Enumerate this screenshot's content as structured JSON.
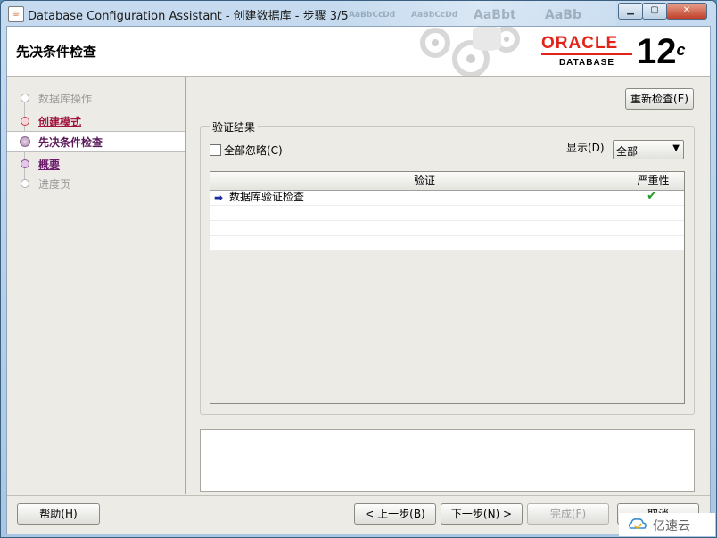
{
  "window": {
    "title": "Database Configuration Assistant - 创建数据库 - 步骤 3/5",
    "ghost_tabs": [
      "AaBbCcDd",
      "AaBbCcDd",
      "AaBbt",
      "AaBb"
    ],
    "minimize_icon": "minimize-icon",
    "maximize_icon": "maximize-icon",
    "close_icon": "close-icon"
  },
  "header": {
    "title": "先决条件检查",
    "brand": "ORACLE",
    "product": "DATABASE",
    "version": "12",
    "version_suffix": "c"
  },
  "sidebar": {
    "steps": [
      {
        "label": "数据库操作",
        "state": "disabled"
      },
      {
        "label": "创建模式",
        "state": "link"
      },
      {
        "label": "先决条件检查",
        "state": "current"
      },
      {
        "label": "概要",
        "state": "link"
      },
      {
        "label": "进度页",
        "state": "disabled"
      }
    ]
  },
  "main": {
    "recheck_button": "重新检查(E)",
    "group_title": "验证结果",
    "ignore_all_label": "全部忽略(C)",
    "ignore_all_checked": false,
    "show_label": "显示(D)",
    "show_value": "全部",
    "table": {
      "columns": [
        "验证",
        "严重性"
      ],
      "rows": [
        {
          "check": "数据库验证检查",
          "severity_icon": "green-check-icon"
        }
      ]
    }
  },
  "footer": {
    "help": "帮助(H)",
    "back": "< 上一步(B)",
    "next": "下一步(N) >",
    "finish": "完成(F)",
    "cancel": "取消"
  },
  "watermark": {
    "text": "亿速云"
  }
}
